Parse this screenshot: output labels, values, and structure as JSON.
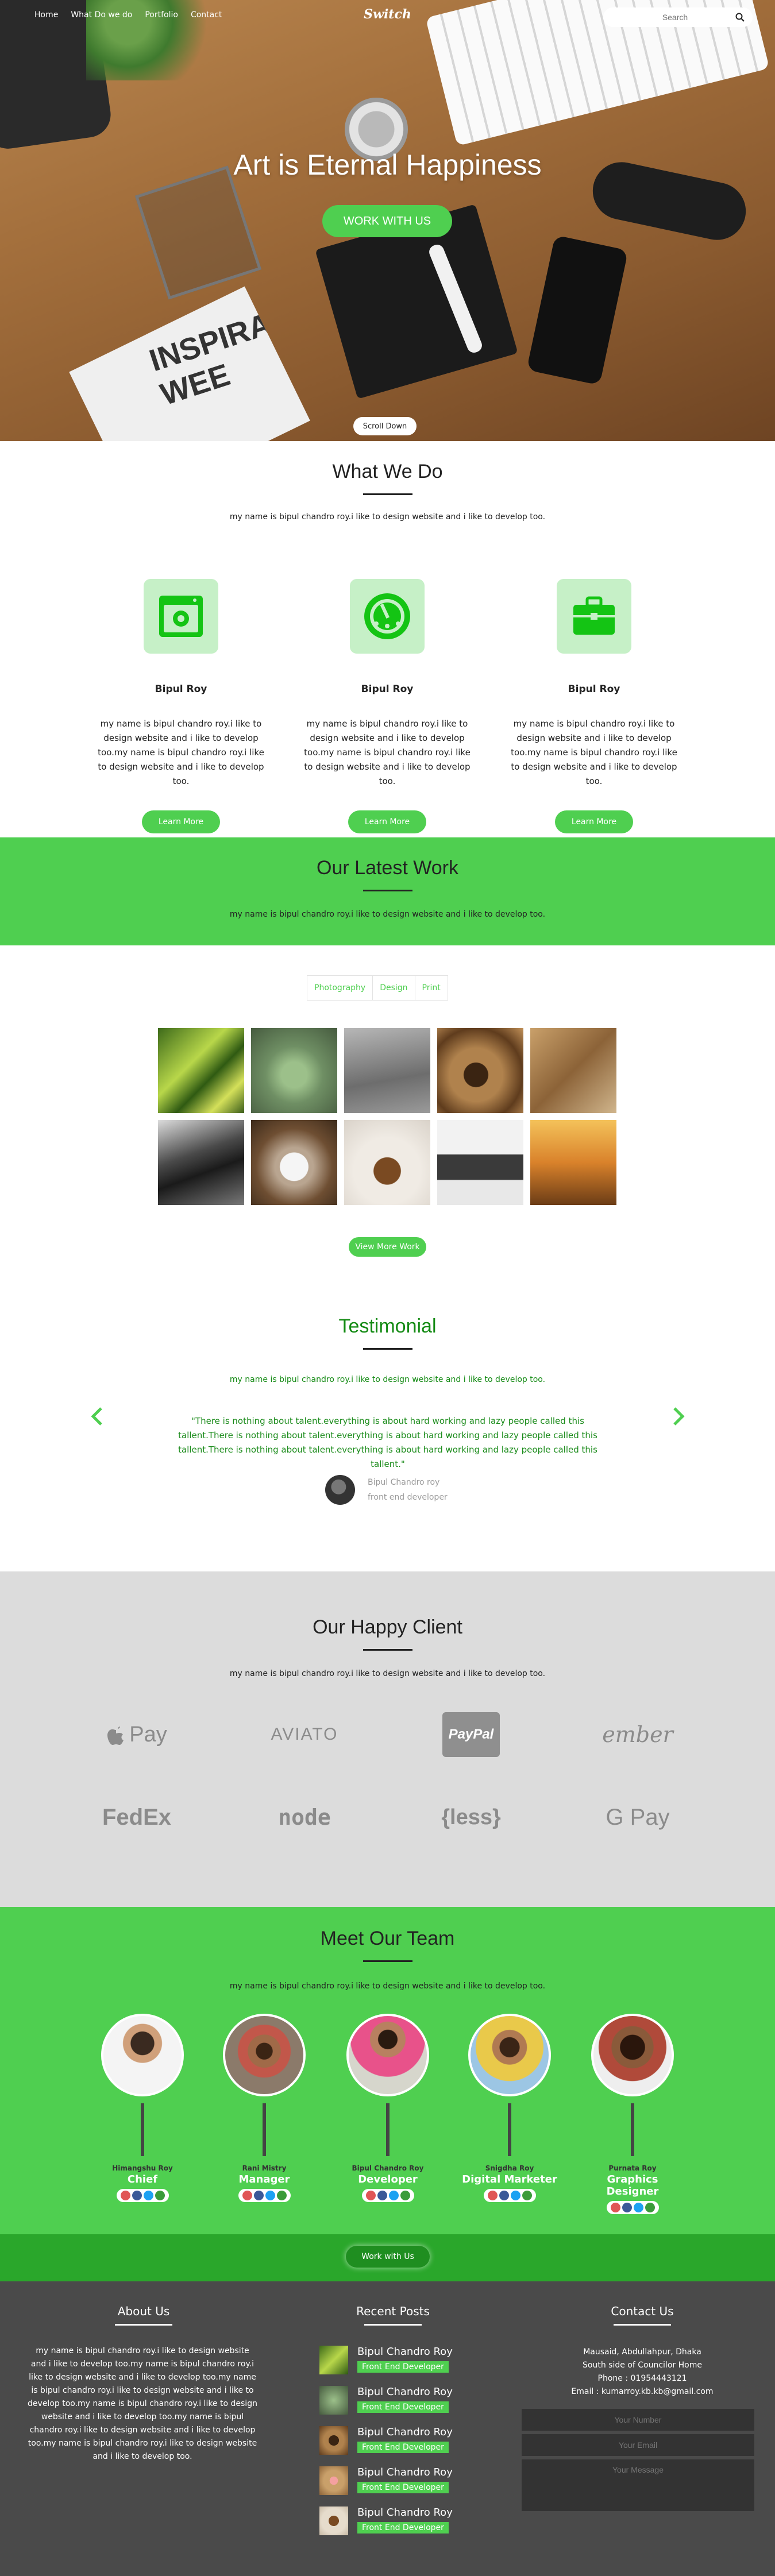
{
  "nav": {
    "items": [
      "Home",
      "What Do we do",
      "Portfolio",
      "Contact"
    ],
    "logo": "Switch",
    "search_placeholder": "Search"
  },
  "hero": {
    "title": "Art is Eternal Happiness",
    "cta": "WORK WITH US",
    "scroll": "Scroll Down",
    "magazine_text": "INSPIRA WEE"
  },
  "what_we_do": {
    "title": "What We Do",
    "subtitle": "my name is bipul chandro roy.i like to design website and i like to develop too.",
    "cards": [
      {
        "icon": "browser-window-icon",
        "name": "Bipul Roy",
        "text": "my name is bipul chandro roy.i like to design website and i like to develop too.my name is bipul chandro roy.i like to design website and i like to develop too.",
        "button": "Learn More"
      },
      {
        "icon": "speedometer-icon",
        "name": "Bipul Roy",
        "text": "my name is bipul chandro roy.i like to design website and i like to develop too.my name is bipul chandro roy.i like to design website and i like to develop too.",
        "button": "Learn More"
      },
      {
        "icon": "briefcase-icon",
        "name": "Bipul Roy",
        "text": "my name is bipul chandro roy.i like to design website and i like to develop too.my name is bipul chandro roy.i like to design website and i like to develop too.",
        "button": "Learn More"
      }
    ]
  },
  "latest_work": {
    "title": "Our Latest Work",
    "subtitle": "my name is bipul chandro roy.i like to design website and i like to develop too.",
    "filters": [
      "Photography",
      "Design",
      "Print"
    ],
    "view_more": "View More Work"
  },
  "testimonial": {
    "title": "Testimonial",
    "subtitle": "my name is bipul chandro roy.i like to design website and i like to develop too.",
    "quote": "\"There is nothing about talent.everything is about hard working and lazy people called this tallent.There is nothing about talent.everything is about hard working and lazy people called this tallent.There is nothing about talent.everything is about hard working and lazy people called this tallent.\"",
    "author": "Bipul Chandro roy",
    "role": "front end developer"
  },
  "clients": {
    "title": "Our Happy Client",
    "subtitle": "my name is bipul chandro roy.i like to design website and i like to develop too.",
    "logos": [
      "Pay",
      "AVIATO",
      "PayPal",
      "ember",
      "FedEx",
      "node",
      "{less}",
      "G Pay"
    ]
  },
  "team": {
    "title": "Meet Our Team",
    "subtitle": "my name is bipul chandro roy.i like to design website and i like to develop too.",
    "members": [
      {
        "name": "Himangshu Roy",
        "role": "Chief"
      },
      {
        "name": "Rani Mistry",
        "role": "Manager"
      },
      {
        "name": "Bipul Chandro Roy",
        "role": "Developer"
      },
      {
        "name": "Snigdha Roy",
        "role": "Digital Marketer"
      },
      {
        "name": "Purnata Roy",
        "role": "Graphics Designer"
      }
    ],
    "cta": "Work with Us"
  },
  "footer": {
    "about_title": "About Us",
    "about_text": "my name is bipul chandro roy.i like to design website and i like to develop too.my name is bipul chandro roy.i like to design website and i like to develop too.my name is bipul chandro roy.i like to design website and i like to develop too.my name is bipul chandro roy.i like to design website and i like to develop too.my name is bipul chandro roy.i like to design website and i like to develop too.my name is bipul chandro roy.i like to design website and i like to develop too.",
    "posts_title": "Recent Posts",
    "posts": [
      {
        "name": "Bipul Chandro Roy",
        "badge": "Front End Developer"
      },
      {
        "name": "Bipul Chandro Roy",
        "badge": "Front End Developer"
      },
      {
        "name": "Bipul Chandro Roy",
        "badge": "Front End Developer"
      },
      {
        "name": "Bipul Chandro Roy",
        "badge": "Front End Developer"
      },
      {
        "name": "Bipul Chandro Roy",
        "badge": "Front End Developer"
      }
    ],
    "contact_title": "Contact Us",
    "address1": "Mausaid, Abdullahpur, Dhaka",
    "address2": "South side of Councilor Home",
    "phone": "Phone : 01954443121",
    "email": "Email : kumarroy.kb.kb@gmail.com",
    "number_placeholder": "Your Number",
    "email_placeholder": "Your Email",
    "message_placeholder": "Your Message"
  },
  "colors": {
    "accent": "#4fcf50",
    "dark_green": "#138a13",
    "footer": "#4a4a4a",
    "client_bg": "#dcdcdc"
  }
}
